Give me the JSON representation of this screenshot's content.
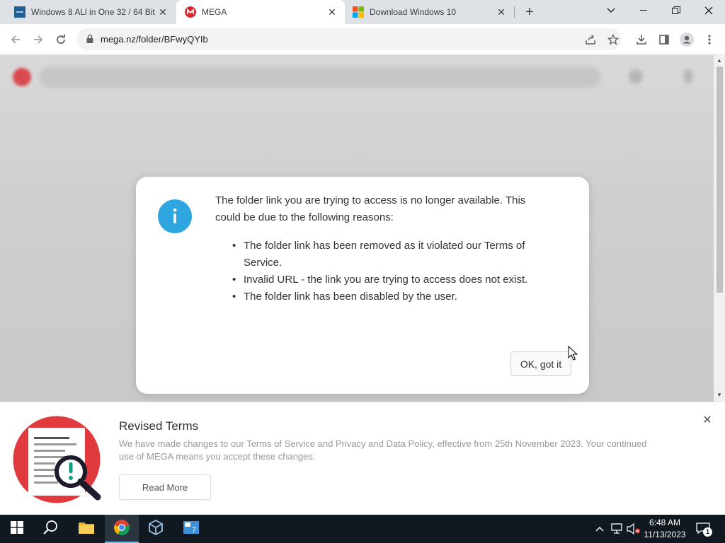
{
  "browser": {
    "tabs": [
      {
        "title": "Windows 8 ALl in One 32 / 64 Bit",
        "active": false
      },
      {
        "title": "MEGA",
        "active": true
      },
      {
        "title": "Download Windows 10",
        "active": false
      }
    ],
    "url": "mega.nz/folder/BFwyQYIb"
  },
  "dialog": {
    "message": "The folder link you are trying to access is no longer available. This could be due to the following reasons:",
    "reasons": [
      "The folder link has been removed as it violated our Terms of Service.",
      "Invalid URL - the link you are trying to access does not exist.",
      "The folder link has been disabled by the user."
    ],
    "ok_label": "OK, got it"
  },
  "banner": {
    "title": "Revised Terms",
    "body": "We have made changes to our Terms of Service and Privacy and Data Policy, effective from 25th November 2023. Your continued use of MEGA means you accept these changes.",
    "read_more_label": "Read More"
  },
  "taskbar": {
    "time": "6:48 AM",
    "date": "11/13/2023",
    "notification_count": "1"
  },
  "colors": {
    "mega_red": "#d9272e",
    "info_blue": "#2fa6e0",
    "taskbar_bg": "#101820"
  }
}
